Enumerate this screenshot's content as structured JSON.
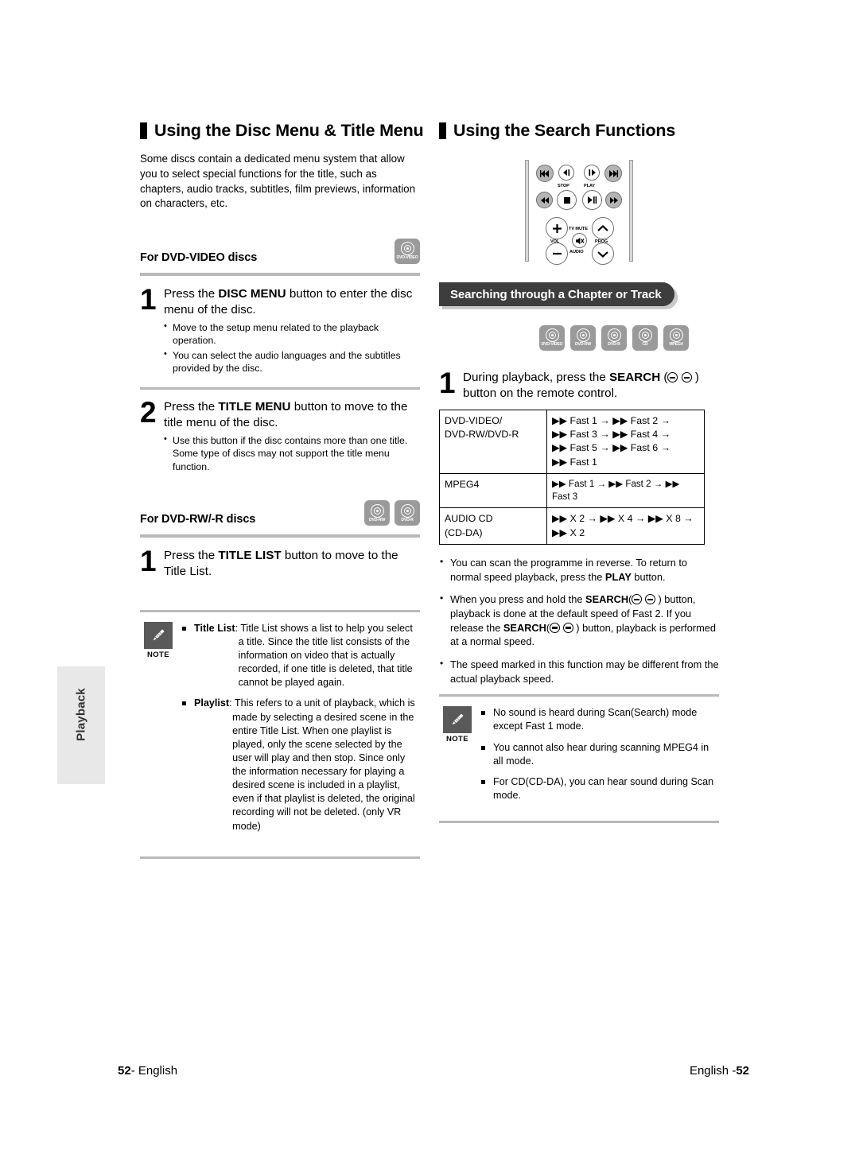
{
  "sidebar": {
    "tab_label": "Playback"
  },
  "left": {
    "heading": "Using the Disc Menu & Title Menu",
    "intro": "Some discs contain a dedicated menu system that allow you to select special functions for the title, such as chapters, audio tracks, subtitles, film previews, information on characters, etc.",
    "subhead_dvdvideo": "For DVD-VIDEO discs",
    "dvdvideo_icons": [
      "DVD-VIDEO"
    ],
    "steps": [
      {
        "num": "1",
        "title_parts": [
          "Press the ",
          "DISC MENU",
          " button to enter the disc menu of the disc."
        ],
        "bullets": [
          "Move to the setup menu related to the playback operation.",
          "You can select the audio languages and the subtitles provided by the disc."
        ]
      },
      {
        "num": "2",
        "title_parts": [
          "Press the ",
          "TITLE MENU",
          " button to move to the title menu of the disc."
        ],
        "bullets": [
          "Use this button if the disc contains more than one title. Some type of discs may not support the title menu function."
        ]
      }
    ],
    "subhead_dvdrw": "For DVD-RW/-R discs",
    "dvdrw_icons": [
      "DVD-RW",
      "DVD-R"
    ],
    "step_titlelist": {
      "num": "1",
      "title_parts": [
        "Press the ",
        "TITLE LIST",
        " button to move to the Title List."
      ]
    },
    "note": {
      "word": "NOTE",
      "items": [
        {
          "term": "Title List",
          "text": ": Title List shows a list to help you select a title. Since the title list consists of the information on video that is actually recorded, if one title is deleted, that title cannot be played again."
        },
        {
          "term": "Playlist",
          "text": ": This refers to a unit of playback, which is made by selecting a desired scene in the entire Title List. When one playlist is played, only the scene selected by the user will play and then stop. Since only the information necessary for playing a desired scene is included in a playlist, even if that playlist is deleted, the original recording will not be deleted. (only VR mode)"
        }
      ]
    }
  },
  "right": {
    "heading": "Using the Search Functions",
    "remote": {
      "labels": [
        "STOP",
        "PLAY",
        "TV MUTE",
        "VOL",
        "PROG",
        "AUDIO"
      ],
      "buttons": [
        "skip-back",
        "step-back",
        "step-forward",
        "skip-forward",
        "rewind",
        "stop",
        "play-pause",
        "fast-forward",
        "vol-up",
        "vol-down",
        "tv-mute",
        "prog-up",
        "prog-down"
      ]
    },
    "banner": "Searching through a Chapter or Track",
    "banner_icons": [
      "DVD-VIDEO",
      "DVD-RW",
      "DVD-R",
      "CD",
      "MPEG4"
    ],
    "step": {
      "num": "1",
      "title_parts": [
        "During playback, press the ",
        "SEARCH",
        " (  ) button on the remote control."
      ]
    },
    "table": {
      "rows": [
        {
          "label": "DVD-VIDEO/\nDVD-RW/DVD-R",
          "lines": [
            "▶▶ Fast 1 →  ▶▶ Fast 2 →",
            "▶▶ Fast 3 →  ▶▶ Fast 4 →",
            "▶▶ Fast 5 →  ▶▶ Fast 6 →",
            "▶▶ Fast 1"
          ]
        },
        {
          "label": "MPEG4",
          "lines": [
            "▶▶ Fast 1 →  ▶▶ Fast 2 →  ▶▶ Fast 3"
          ]
        },
        {
          "label": "AUDIO CD\n(CD-DA)",
          "lines": [
            "▶▶ X 2 →  ▶▶ X 4 →  ▶▶ X 8 →",
            "▶▶ X 2"
          ]
        }
      ]
    },
    "bullets": [
      {
        "pre": "You can scan the programme in reverse. To return to normal speed playback, press the ",
        "bold": "PLAY",
        "post": " button."
      },
      {
        "pre": "When you press and hold the ",
        "bold": "SEARCH",
        "post": "(  ) button, playback is done at the default speed of Fast 2. If you release the ",
        "bold2": "SEARCH",
        "post2": "(  ) button, playback is performed at a normal speed."
      },
      {
        "pre": "The speed marked in this function may be different from the actual playback speed.",
        "bold": "",
        "post": ""
      }
    ],
    "note": {
      "word": "NOTE",
      "items": [
        "No sound is heard during Scan(Search) mode except Fast 1 mode.",
        "You cannot also hear during scanning MPEG4 in all mode.",
        "For CD(CD-DA), you can hear sound during Scan mode."
      ]
    }
  },
  "footer": {
    "left_num": "52",
    "left_text": "- English",
    "right_text": "English -",
    "right_num": "52"
  }
}
